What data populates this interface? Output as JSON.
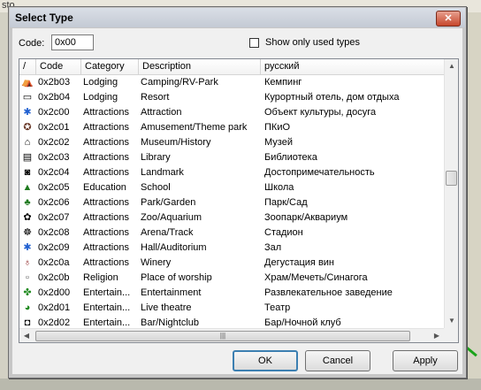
{
  "background": {
    "app_fragment_text": "sto"
  },
  "dialog": {
    "title": "Select Type",
    "close_glyph": "✕",
    "code_label": "Code:",
    "code_value": "0x00",
    "show_used_label": "Show only used types",
    "show_used_checked": false
  },
  "list": {
    "sort_glyph": "/",
    "columns": [
      "Code",
      "Category",
      "Description",
      "русский"
    ],
    "rows": [
      {
        "icon": "camping-icon",
        "glyph": "⛺",
        "color": "#2a7a2a",
        "code": "0x2b03",
        "category": "Lodging",
        "description": "Camping/RV-Park",
        "ru": "Кемпинг"
      },
      {
        "icon": "bed-icon",
        "glyph": "▭",
        "color": "#000000",
        "code": "0x2b04",
        "category": "Lodging",
        "description": "Resort",
        "ru": "Курортный отель, дом отдыха"
      },
      {
        "icon": "attraction-icon",
        "glyph": "✱",
        "color": "#1f5fd0",
        "code": "0x2c00",
        "category": "Attractions",
        "description": "Attraction",
        "ru": "Объект культуры, досуга"
      },
      {
        "icon": "amusement-park-icon",
        "glyph": "✪",
        "color": "#6a3a2a",
        "code": "0x2c01",
        "category": "Attractions",
        "description": "Amusement/Theme park",
        "ru": "ПКиО"
      },
      {
        "icon": "museum-icon",
        "glyph": "⌂",
        "color": "#000000",
        "code": "0x2c02",
        "category": "Attractions",
        "description": "Museum/History",
        "ru": "Музей"
      },
      {
        "icon": "library-icon",
        "glyph": "▤",
        "color": "#000000",
        "code": "0x2c03",
        "category": "Attractions",
        "description": "Library",
        "ru": "Библиотека"
      },
      {
        "icon": "camera-icon",
        "glyph": "◙",
        "color": "#000000",
        "code": "0x2c04",
        "category": "Attractions",
        "description": "Landmark",
        "ru": "Достопримечательность"
      },
      {
        "icon": "school-icon",
        "glyph": "▲",
        "color": "#1f7a1f",
        "code": "0x2c05",
        "category": "Education",
        "description": "School",
        "ru": "Школа"
      },
      {
        "icon": "tree-icon",
        "glyph": "♣",
        "color": "#1f7a1f",
        "code": "0x2c06",
        "category": "Attractions",
        "description": "Park/Garden",
        "ru": "Парк/Сад"
      },
      {
        "icon": "zoo-icon",
        "glyph": "✿",
        "color": "#000000",
        "code": "0x2c07",
        "category": "Attractions",
        "description": "Zoo/Aquarium",
        "ru": "Зоопарк/Аквариум"
      },
      {
        "icon": "arena-icon",
        "glyph": "☸",
        "color": "#000000",
        "code": "0x2c08",
        "category": "Attractions",
        "description": "Arena/Track",
        "ru": "Стадион"
      },
      {
        "icon": "hall-icon",
        "glyph": "✱",
        "color": "#1f5fd0",
        "code": "0x2c09",
        "category": "Attractions",
        "description": "Hall/Auditorium",
        "ru": "Зал"
      },
      {
        "icon": "wine-glass-icon",
        "glyph": "♁",
        "color": "#8a1f1f",
        "code": "0x2c0a",
        "category": "Attractions",
        "description": "Winery",
        "ru": "Дегустация вин"
      },
      {
        "icon": "worship-icon",
        "glyph": "▫",
        "color": "#555555",
        "code": "0x2c0b",
        "category": "Religion",
        "description": "Place of worship",
        "ru": "Храм/Мечеть/Синагога"
      },
      {
        "icon": "entertainment-icon",
        "glyph": "✤",
        "color": "#1f8a1f",
        "code": "0x2d00",
        "category": "Entertain...",
        "description": "Entertainment",
        "ru": "Развлекательное заведение"
      },
      {
        "icon": "theatre-icon",
        "glyph": "◕",
        "color": "#1f8a1f",
        "code": "0x2d01",
        "category": "Entertain...",
        "description": "Live theatre",
        "ru": "Театр"
      },
      {
        "icon": "bar-icon",
        "glyph": "◘",
        "color": "#000000",
        "code": "0x2d02",
        "category": "Entertain...",
        "description": "Bar/Nightclub",
        "ru": "Бар/Ночной клуб"
      }
    ]
  },
  "buttons": {
    "ok": "OK",
    "cancel": "Cancel",
    "apply": "Apply"
  }
}
